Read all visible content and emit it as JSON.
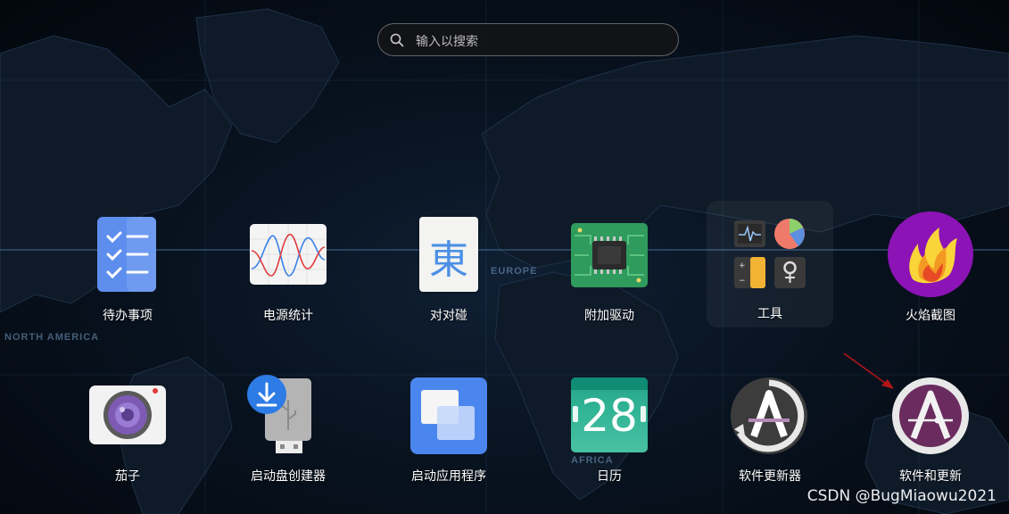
{
  "search": {
    "placeholder": "输入以搜索"
  },
  "map_labels": {
    "europe": "EUROPE",
    "north_america": "NORTH AMERICA",
    "africa": "AFRICA"
  },
  "apps": {
    "todo": {
      "label": "待办事项",
      "icon": "todo-checklist-icon"
    },
    "power": {
      "label": "电源统计",
      "icon": "power-statistics-chart-icon"
    },
    "duiduipeng": {
      "label": "对对碰",
      "icon": "dong-character-tile-icon",
      "glyph": "東"
    },
    "driver": {
      "label": "附加驱动",
      "icon": "chip-board-icon"
    },
    "tools": {
      "label": "工具",
      "icon": "tools-folder-icon"
    },
    "flameshot": {
      "label": "火焰截图",
      "icon": "flameshot-icon"
    },
    "cheese": {
      "label": "茄子",
      "icon": "camera-icon"
    },
    "usb": {
      "label": "启动盘创建器",
      "icon": "usb-download-icon"
    },
    "app_launcher": {
      "label": "启动应用程序",
      "icon": "startup-apps-icon"
    },
    "calendar": {
      "label": "日历",
      "icon": "calendar-icon",
      "day": "28"
    },
    "software_updater": {
      "label": "软件更新器",
      "icon": "software-updater-icon"
    },
    "software_properties": {
      "label": "软件和更新",
      "icon": "software-properties-icon"
    }
  },
  "watermark": "CSDN @BugMiaowu2021"
}
